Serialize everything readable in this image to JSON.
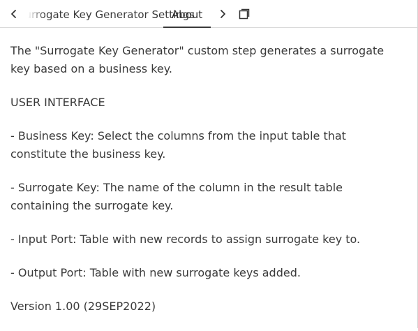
{
  "tabs": {
    "items": [
      {
        "label": "Surrogate Key Generator Settings"
      },
      {
        "label": "About"
      }
    ],
    "active": "About",
    "scroll_left_icon": "chevron-left-icon",
    "scroll_right_icon": "chevron-right-icon",
    "maximize_icon": "maximize-window-icon"
  },
  "about": {
    "intro": "The \"Surrogate Key Generator\" custom step generates a surrogate key based on a business key.",
    "ui_heading": "USER INTERFACE",
    "business_key": "- Business Key: Select the columns from the input table that constitute the business key.",
    "surrogate_key": "- Surrogate Key: The name of the column in the result table containing the surrogate key.",
    "input_port": "- Input Port: Table with new records to assign surrogate key to.",
    "output_port": "- Output Port: Table with new surrogate keys added.",
    "version": "Version 1.00 (29SEP2022)"
  },
  "colors": {
    "text": "#3a3a3a",
    "divider": "#d9d9d9",
    "active_tab_underline": "#3a3a3a"
  }
}
